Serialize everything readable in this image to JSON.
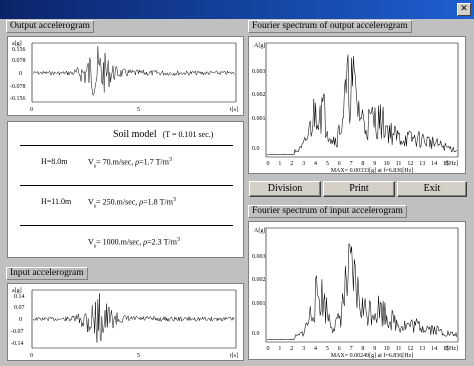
{
  "window": {
    "title": ""
  },
  "output_accelerogram": {
    "label": "Output accelerogram",
    "y_unit": "a[g]",
    "x_unit": "t[s]",
    "y_ticks": [
      "0.156",
      "0.078",
      "0",
      "-0.078",
      "-0.156"
    ],
    "x_ticks": [
      "0",
      "5"
    ]
  },
  "input_accelerogram": {
    "label": "Input accelerogram",
    "y_unit": "a[g]",
    "x_unit": "t[s]",
    "y_ticks": [
      "0.14",
      "0.07",
      "0",
      "-0.07",
      "-0.14"
    ],
    "x_ticks": [
      "0",
      "5"
    ]
  },
  "soil_model": {
    "title": "Soil model",
    "period": "(T = 0.101 sec.)",
    "layers": [
      {
        "h": "H=8.0m",
        "vs_value": "= 70.m/sec,",
        "rho_value": "=1.7 T/m"
      },
      {
        "h": "H=11.0m",
        "vs_value": "= 250.m/sec,",
        "rho_value": "=1.8 T/m"
      },
      {
        "h": "",
        "vs_value": "= 1000.m/sec,",
        "rho_value": "=2.3 T/m"
      }
    ]
  },
  "fourier_output": {
    "label": "Fourier spectrum of output accelerogram",
    "y_unit": "A[g]",
    "x_unit": "f[Hz]",
    "y_ticks": [
      "0.003",
      "0.002",
      "0.001",
      "0.0"
    ],
    "x_ticks": [
      "0",
      "1",
      "2",
      "3",
      "4",
      "5",
      "6",
      "7",
      "8",
      "9",
      "10",
      "11",
      "12",
      "13",
      "14",
      "15"
    ],
    "max_text": "MAX= 0.00333[g]   at   f=6.836[Hz]"
  },
  "fourier_input": {
    "label": "Fourier spectrum of input accelerogram",
    "y_unit": "A[g]",
    "x_unit": "f[Hz]",
    "y_ticks": [
      "0.003",
      "0.002",
      "0.001",
      "0.0"
    ],
    "x_ticks": [
      "0",
      "1",
      "2",
      "3",
      "4",
      "5",
      "6",
      "7",
      "8",
      "9",
      "10",
      "11",
      "12",
      "13",
      "14",
      "15"
    ],
    "max_text": "MAX= 0.00249[g]   at   f=6.836[Hz]"
  },
  "buttons": {
    "division": "Division",
    "print": "Print",
    "exit": "Exit"
  },
  "colors": {
    "titlebar": "#0a246a",
    "background": "#c0c0c0",
    "plot_bg": "#ffffff",
    "trace": "#000000"
  }
}
